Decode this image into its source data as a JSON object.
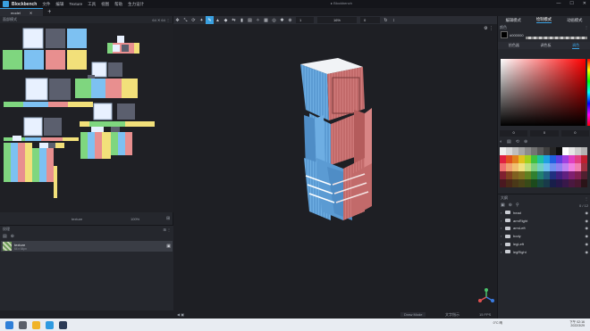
{
  "title_bar": {
    "app_name": "Blockbench",
    "menus": [
      "文件",
      "编辑",
      "Texture",
      "工具",
      "视图",
      "帮助",
      "生力设计"
    ],
    "window_title": "▸ Blockbench",
    "controls": [
      "—",
      "☐",
      "✕"
    ]
  },
  "tabs": [
    {
      "label": "model",
      "close": "✕"
    }
  ],
  "tab_add": "+",
  "left_panel": {
    "title": "面部模式",
    "controls": "64 ✕ 64 ⋮",
    "uv_footer_left": "texture",
    "uv_footer_right": "100%",
    "textures": {
      "title": "纹理",
      "actions": "⊞ ⋮",
      "items": [
        {
          "name": "texture",
          "sub": "64 x 64px",
          "save": "▣"
        }
      ]
    }
  },
  "toolbar": {
    "tools": [
      "✥",
      "⤡",
      "⟳",
      "✦",
      "✎",
      "▲",
      "◆",
      "⇆",
      "▮",
      "▤",
      "✧",
      "▦",
      "◎",
      "✱",
      "⊕",
      "↻",
      "↕"
    ],
    "inputs": [
      "1",
      "16%",
      "0"
    ]
  },
  "viewport_footer": {
    "left": "◀ ▣",
    "center": "Draw Mode",
    "right_label": "文字指示",
    "fps": "15 FPS"
  },
  "right_panel": {
    "modes": [
      "编辑模式",
      "绘制模式",
      "动画模式"
    ],
    "color_title": "颜色",
    "hex": "#000000",
    "color_tabs": [
      "拾色器",
      "调色板",
      "调色"
    ],
    "values": [
      "0",
      "0",
      "0"
    ],
    "palette_tools": [
      "◐",
      "▤",
      "⟲",
      "⊕"
    ],
    "outliner": {
      "title": "大纲",
      "tools": [
        "▣",
        "⊕",
        "⚲"
      ],
      "count": "0 / 12",
      "groups": [
        "head",
        "armRight",
        "armLeft",
        "body",
        "legLeft",
        "legRight"
      ]
    }
  },
  "taskbar": {
    "weather": "0°C 晴",
    "time": "下午 02:16",
    "date": "2022/3/29"
  },
  "colors": {
    "accent": "#3aa0e0",
    "model_blue": "#5b9bd3",
    "model_red": "#c26a6a"
  }
}
